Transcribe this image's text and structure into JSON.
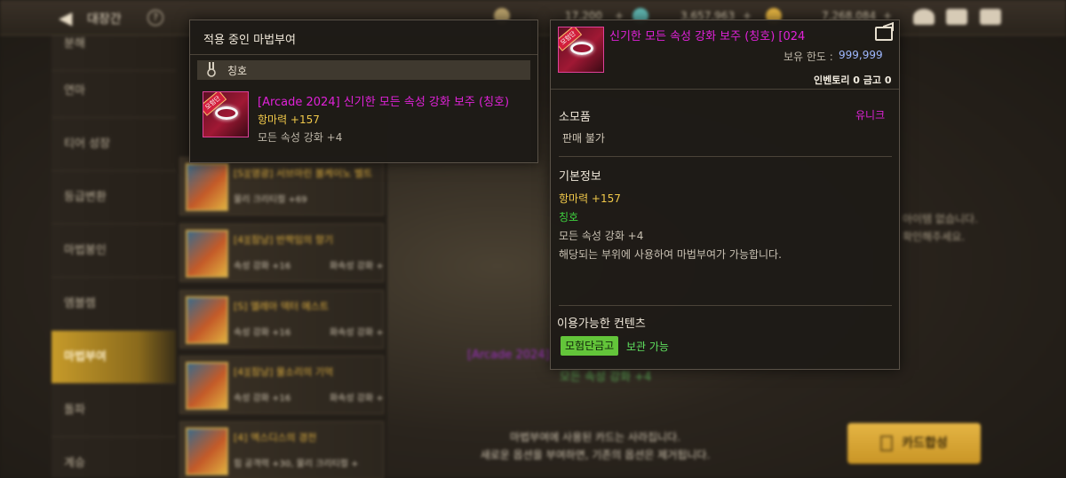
{
  "topbar": {
    "back_icon": "back-arrow-icon",
    "title": "대장간",
    "help_glyph": "?",
    "currencies": [
      {
        "icon": "moon-coin-icon",
        "value": "17,200",
        "color": "#b8a06a"
      },
      {
        "icon": "crystal-icon",
        "value": "3,657,963",
        "color": "#5fb6b0"
      },
      {
        "icon": "gold-coin-icon",
        "value": "7,268,084",
        "color": "#e0b040"
      }
    ],
    "plus_glyph": "+",
    "icons": [
      "forge-icon",
      "mail-icon",
      "chat-icon"
    ]
  },
  "sidebar": {
    "items": [
      {
        "label": "분해"
      },
      {
        "label": "연마"
      },
      {
        "label": "티어 성장"
      },
      {
        "label": "등급변환"
      },
      {
        "label": "마법봉인"
      },
      {
        "label": "엠블렘"
      },
      {
        "label": "마법부여",
        "active": true
      },
      {
        "label": "돌파"
      },
      {
        "label": "계승"
      }
    ]
  },
  "cards": [
    {
      "name": "[S][영광] 서브마린 볼케이노 벨트",
      "opt1": "물리 크리티컬 +69",
      "opt2": ""
    },
    {
      "name": "[4][잠낭] 반짝임의 향기",
      "opt1": "속성 강화 +16",
      "opt2": "화속성 강화 +"
    },
    {
      "name": "[S] 엘레아 덱터 에스트",
      "opt1": "속성 강화 +16",
      "opt2": "화속성 강화 +"
    },
    {
      "name": "[4][잠낭] 물소리의 기억",
      "opt1": "속성 강화 +16",
      "opt2": "화속성 강화 +"
    },
    {
      "name": "[4] 엑스디스의 경전",
      "opt1": "힘 공격력 +30, 물리 크리티컬 +",
      "opt2": ""
    }
  ],
  "center": {
    "ghost_name": "[Arcade 2024]",
    "ghost_stat": "모든 속성 강화 +4",
    "note_line1": "마법부여에 사용된 카드는 사라집니다.",
    "note_line2": "새로운 옵션을 부여하면, 기존의 옵션은 제거됩니다.",
    "right_note1": "아이템 없습니다.",
    "right_note2": "확인해주세요.",
    "combine_button": "카드합성"
  },
  "current_enchant": {
    "title": "적용 중인 마법부여",
    "slot_icon": "medal-icon",
    "slot_label": "칭호",
    "item_icon": "title-ring-icon",
    "item_ribbon": "모험단",
    "item_name": "[Arcade 2024] 신기한 모든 속성 강화 보주 (칭호)",
    "stat_main": "항마력 +157",
    "stat_sub": "모든 속성 강화 +4"
  },
  "item_detail": {
    "name_visible": "024] 신기한 모든 속성 강화 보주 (칭호)",
    "icon": "title-ring-icon",
    "ribbon": "모험단",
    "share_icon": "share-icon",
    "limit_label": "보유 한도 :",
    "limit_value": "999,999",
    "inventory": "인벤토리 0 금고 0",
    "type": "소모품",
    "rarity": "유니크",
    "sellable": "판매 불가",
    "basic_info_title": "기본정보",
    "basic_lines": [
      "항마력 +157",
      "칭호",
      "모든 속성 강화 +4",
      "해당되는 부위에 사용하여 마법부여가 가능합니다."
    ],
    "content_title": "이용가능한 컨텐츠",
    "content_badge": "모험단금고",
    "content_status": "보관 가능"
  },
  "colors": {
    "unique": "#e022d8",
    "stat_gold": "#f0c84a",
    "stat_green": "#3fd23f",
    "accent_gold": "#c99526"
  }
}
